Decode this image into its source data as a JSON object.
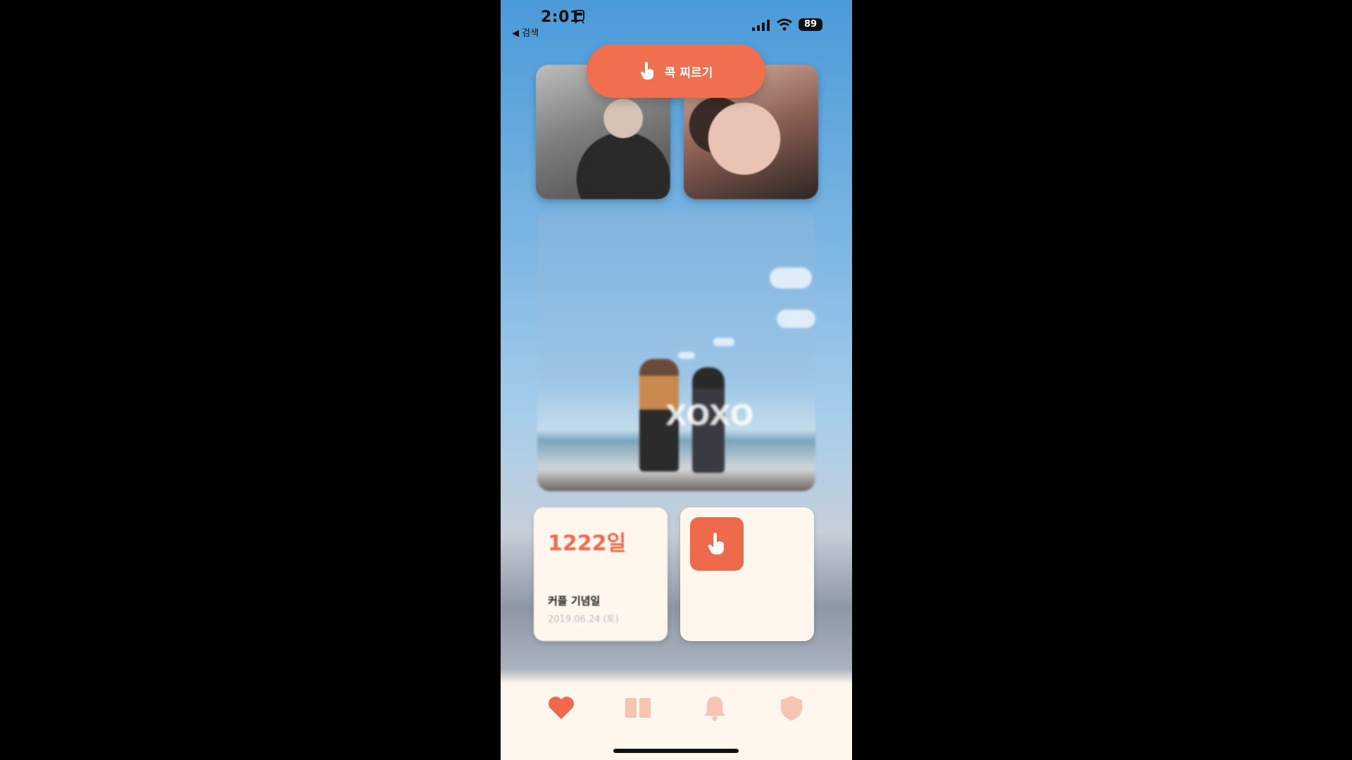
{
  "status_bar": {
    "time": "2:01",
    "back_label": "◀ 검색",
    "battery": "89"
  },
  "poke_banner": {
    "label": "콕 찌르기",
    "icon": "hand-pointer-icon"
  },
  "profiles": [
    {
      "name": "",
      "status": ""
    },
    {
      "name": "",
      "status": ""
    }
  ],
  "photo": {
    "overlay_text": "XOXO"
  },
  "anniversary": {
    "days": "1222일",
    "label": "커플 기념일",
    "date": "2019.06.24 (토)"
  },
  "poke_widget": {
    "icon": "hand-pointer-icon"
  },
  "tabs": [
    {
      "icon": "heart-icon",
      "active": true
    },
    {
      "icon": "book-icon",
      "active": false
    },
    {
      "icon": "bell-icon",
      "active": false
    },
    {
      "icon": "shield-icon",
      "active": false
    }
  ],
  "colors": {
    "accent": "#EF6A4B",
    "tile_bg": "#FFF6EE",
    "inactive_tab": "#F7C3B3"
  }
}
